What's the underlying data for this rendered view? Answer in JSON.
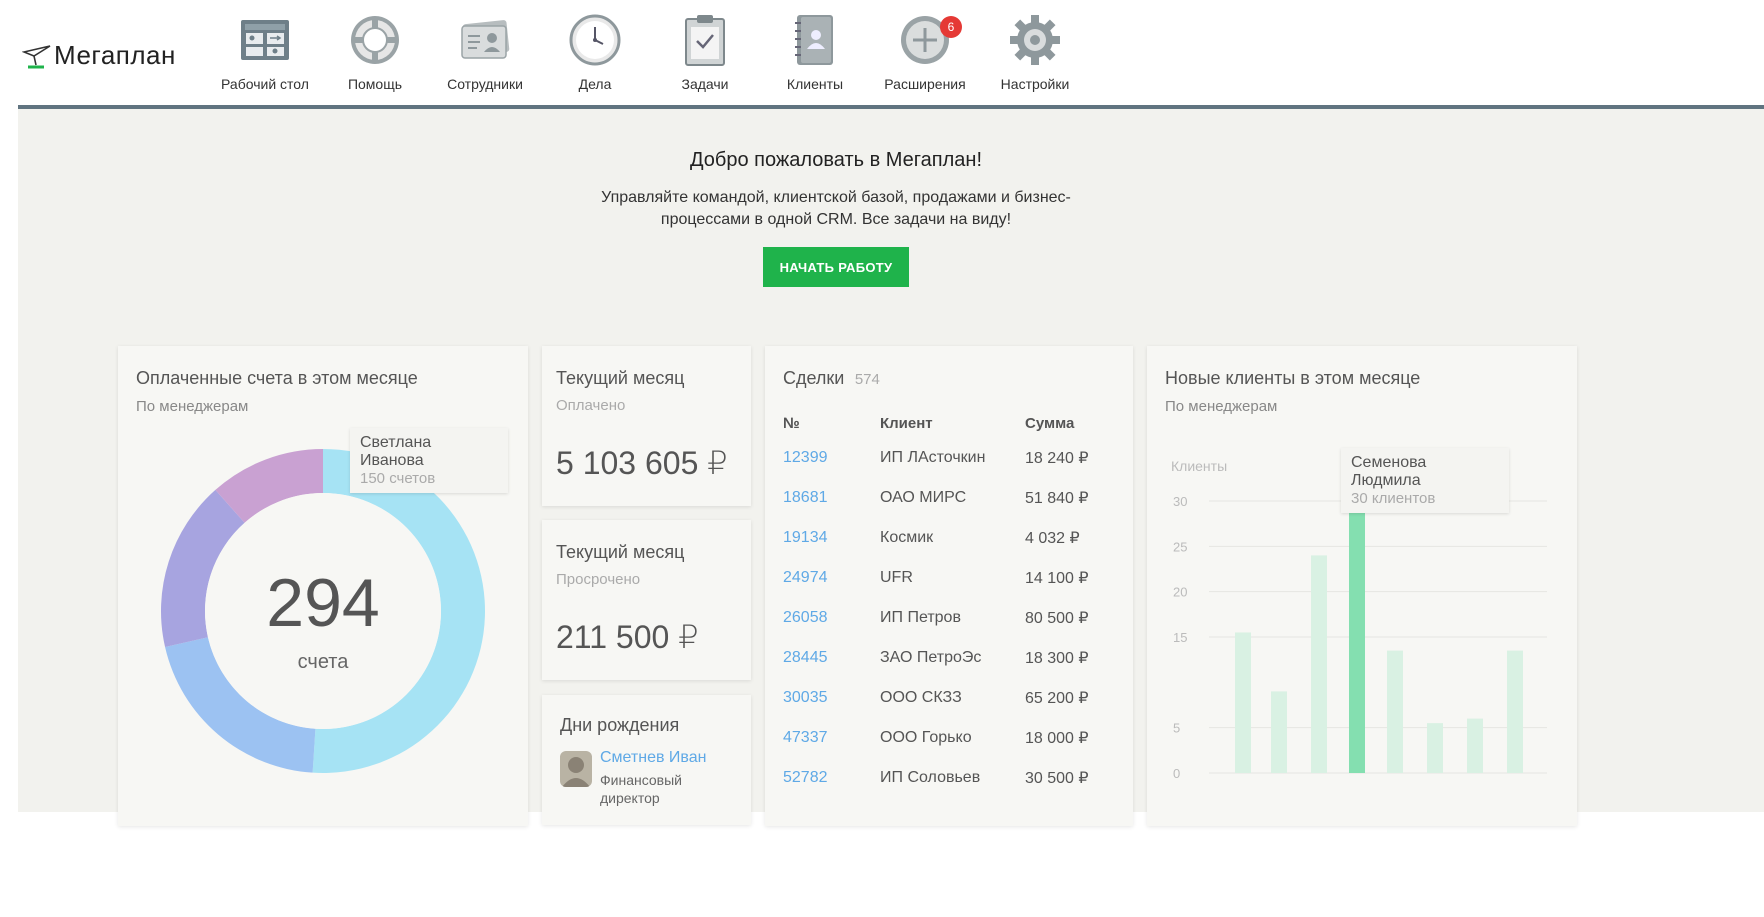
{
  "app": {
    "logo_text": "Мегаплан"
  },
  "nav": {
    "items": [
      {
        "label": "Рабочий стол",
        "icon": "desktop-icon",
        "active": true
      },
      {
        "label": "Помощь",
        "icon": "lifebuoy-icon"
      },
      {
        "label": "Сотрудники",
        "icon": "employees-icon"
      },
      {
        "label": "Дела",
        "icon": "clock-icon"
      },
      {
        "label": "Задачи",
        "icon": "clipboard-check-icon"
      },
      {
        "label": "Клиенты",
        "icon": "contact-book-icon"
      },
      {
        "label": "Расширения",
        "icon": "plus-circle-icon",
        "badge": "6"
      },
      {
        "label": "Настройки",
        "icon": "gear-icon"
      }
    ]
  },
  "welcome": {
    "title": "Добро пожаловать в Мегаплан!",
    "text": "Управляйте командой, клиентской базой, продажами и бизнес-процессами в одной CRM. Все задачи на виду!",
    "button": "НАЧАТЬ РАБОТУ"
  },
  "paid_card": {
    "title": "Оплаченные счета в этом месяце",
    "subtitle": "По менеджерам",
    "center_value": "294",
    "center_label": "счета",
    "tooltip_name": "Светлана Иванова",
    "tooltip_value": "150 счетов"
  },
  "month_paid": {
    "title": "Текущий месяц",
    "subtitle": "Оплачено",
    "value": "5 103 605 ₽"
  },
  "month_overdue": {
    "title": "Текущий месяц",
    "subtitle": "Просрочено",
    "value": "211 500 ₽"
  },
  "birthdays": {
    "title": "Дни рождения",
    "person_name": "Сметнев Иван",
    "person_role": "Финансовый директор"
  },
  "deals": {
    "title": "Сделки",
    "count": "574",
    "headers": [
      "№",
      "Клиент",
      "Сумма"
    ],
    "rows": [
      [
        "12399",
        "ИП ЛАсточкин",
        "18 240 ₽"
      ],
      [
        "18681",
        "ОАО МИРС",
        "51 840 ₽"
      ],
      [
        "19134",
        "Космик",
        "4 032 ₽"
      ],
      [
        "24974",
        "UFR",
        "14 100 ₽"
      ],
      [
        "26058",
        "ИП Петров",
        "80 500 ₽"
      ],
      [
        "28445",
        "ЗАО ПетроЭс",
        "18 300 ₽"
      ],
      [
        "30035",
        "ООО СКЗЗ",
        "65 200 ₽"
      ],
      [
        "47337",
        "ООО Горько",
        "18 000 ₽"
      ],
      [
        "52782",
        "ИП Соловьев",
        "30 500 ₽"
      ]
    ]
  },
  "new_clients": {
    "title": "Новые клиенты в этом месяце",
    "subtitle": "По менеджерам",
    "tooltip_name": "Семенова Людмила",
    "tooltip_value": "30 клиентов"
  },
  "chart_data": [
    {
      "type": "pie",
      "title": "Оплаченные счета в этом месяце",
      "total": 294,
      "slices": [
        {
          "value": 150,
          "color": "#a6e3f4"
        },
        {
          "value": 60,
          "color": "#9cc2f2"
        },
        {
          "value": 50,
          "color": "#a7a4e0"
        },
        {
          "value": 34,
          "color": "#c9a1d2"
        }
      ]
    },
    {
      "type": "bar",
      "title": "Новые клиенты в этом месяце",
      "ylabel": "Клиенты",
      "ylim": [
        0,
        30
      ],
      "yticks": [
        0,
        5,
        15,
        20,
        25,
        30
      ],
      "values": [
        15.5,
        9,
        24,
        30,
        13.5,
        5.5,
        6,
        13.5
      ],
      "highlight_index": 3,
      "bar_color": "#d9f1e3",
      "highlight_color": "#84dfb0"
    }
  ]
}
